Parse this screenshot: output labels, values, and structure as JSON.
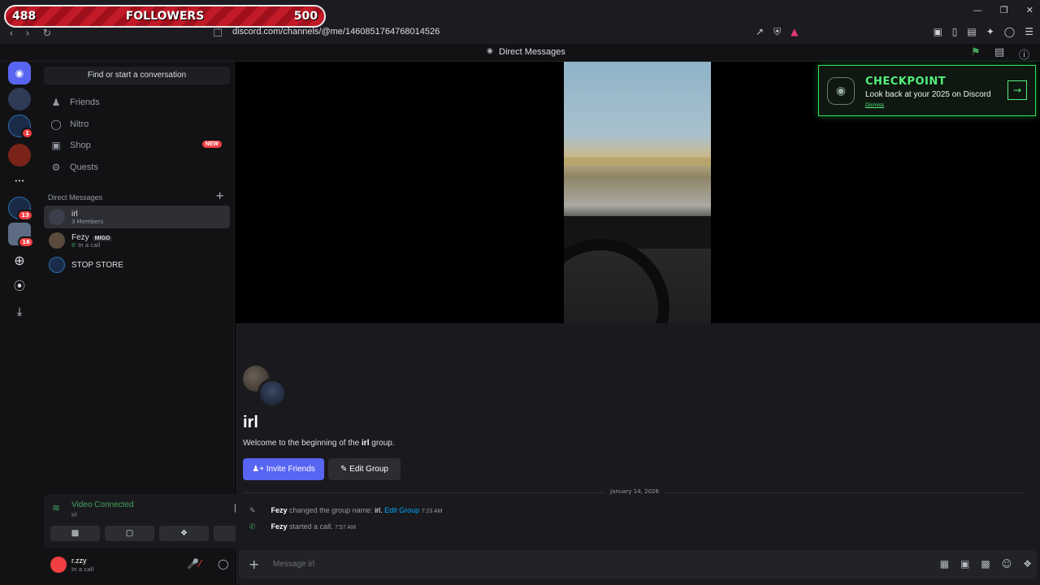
{
  "overlay": {
    "count": "488",
    "label": "FOLLOWERS",
    "goal": "500"
  },
  "browser": {
    "url": "discord.com/channels/@me/1460851764768014526"
  },
  "header": {
    "title": "Direct Messages"
  },
  "sidebar": {
    "search_placeholder": "Find or start a conversation",
    "nav": [
      {
        "label": "Friends"
      },
      {
        "label": "Nitro"
      },
      {
        "label": "Shop",
        "badge": "NEW"
      },
      {
        "label": "Quests"
      }
    ],
    "dm_header": "Direct Messages",
    "dms": [
      {
        "name": "irl",
        "sub": "3 Members"
      },
      {
        "name": "Fezy",
        "tag": "MIGO",
        "sub": "In a call"
      },
      {
        "name": "STOP STORE"
      }
    ]
  },
  "rail_badges": [
    "1",
    "13",
    "16"
  ],
  "voice": {
    "title": "Video Connected",
    "channel": "irl"
  },
  "user": {
    "name": "r.zzy",
    "status": "In a call"
  },
  "checkpoint": {
    "title": "CHECKPOINT",
    "subtitle": "Look back at your 2025 on Discord",
    "dismiss": "Dismiss"
  },
  "channel": {
    "title": "irl",
    "welcome_prefix": "Welcome to the beginning of the",
    "welcome_bold": "irl",
    "welcome_suffix": "group.",
    "invite_label": "Invite Friends",
    "edit_label": "Edit Group",
    "date_divider": "January 14, 2026"
  },
  "messages": [
    {
      "author": "Fezy",
      "text": "changed the group name:",
      "value": "irl.",
      "link": "Edit Group",
      "time": "7:23 AM"
    },
    {
      "author": "Fezy",
      "text": "started a call.",
      "time": "7:57 AM"
    }
  ],
  "composer": {
    "placeholder": "Message irl"
  }
}
